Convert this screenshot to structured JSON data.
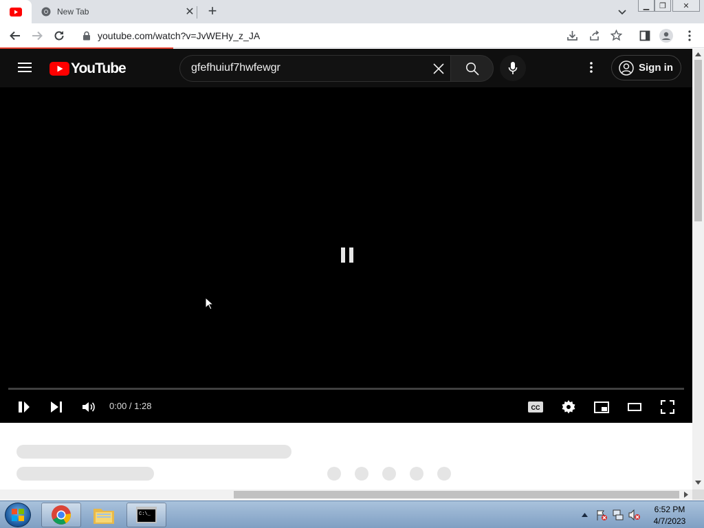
{
  "browser": {
    "tabs": [
      {
        "label": "",
        "icon": "youtube-favicon",
        "active": true
      },
      {
        "label": "New Tab",
        "icon": "chrome-favicon",
        "active": false
      }
    ],
    "url": "youtube.com/watch?v=JvWEHy_z_JA",
    "accent_color": "#e8402f"
  },
  "youtube": {
    "logo_text": "YouTube",
    "search": {
      "value": "gfefhuiuf7hwfewgr"
    },
    "signin_label": "Sign in"
  },
  "player": {
    "state": "paused-overlay",
    "time_display": "0:00 / 1:28",
    "progress_fraction": 0.0
  },
  "taskbar": {
    "items": [
      "start-orb",
      "chrome",
      "file-explorer",
      "command-prompt"
    ],
    "clock_time": "6:52 PM",
    "clock_date": "4/7/2023"
  }
}
